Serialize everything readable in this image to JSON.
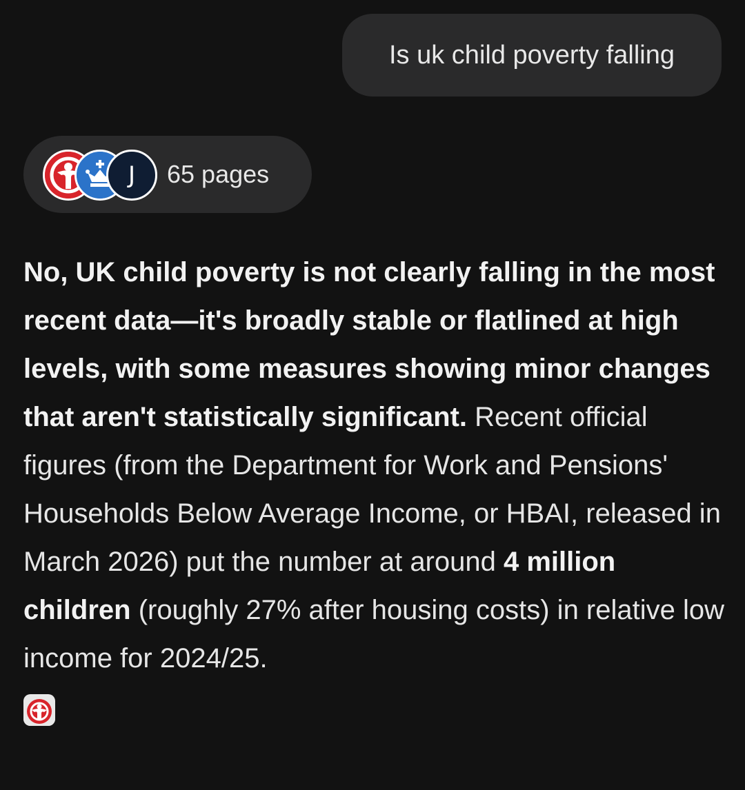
{
  "user_query": {
    "text": "Is uk child poverty falling"
  },
  "sources": {
    "count_label": "65 pages",
    "favicons": [
      {
        "icon": "charity-logo-icon",
        "color": "#d8242b"
      },
      {
        "icon": "crown-logo-icon",
        "color": "#2b73c9"
      },
      {
        "icon": "letter-j-logo-icon",
        "letter": "J",
        "color": "#0f1d33"
      }
    ]
  },
  "answer": {
    "bold_lead": "No, UK child poverty is not clearly falling in the most recent data—it's broadly stable or flatlined at high levels, with some measures showing minor changes that aren't statistically significant.",
    "text_1": " Recent official figures (from the Department for Work and Pensions' Households Below Average Income, or HBAI, released in March 2026) put the number at around ",
    "bold_figure": "4 million children",
    "text_2": " (roughly 27% after housing costs) in relative low income for 2024/25.",
    "citation_icon": "charity-logo-icon"
  }
}
